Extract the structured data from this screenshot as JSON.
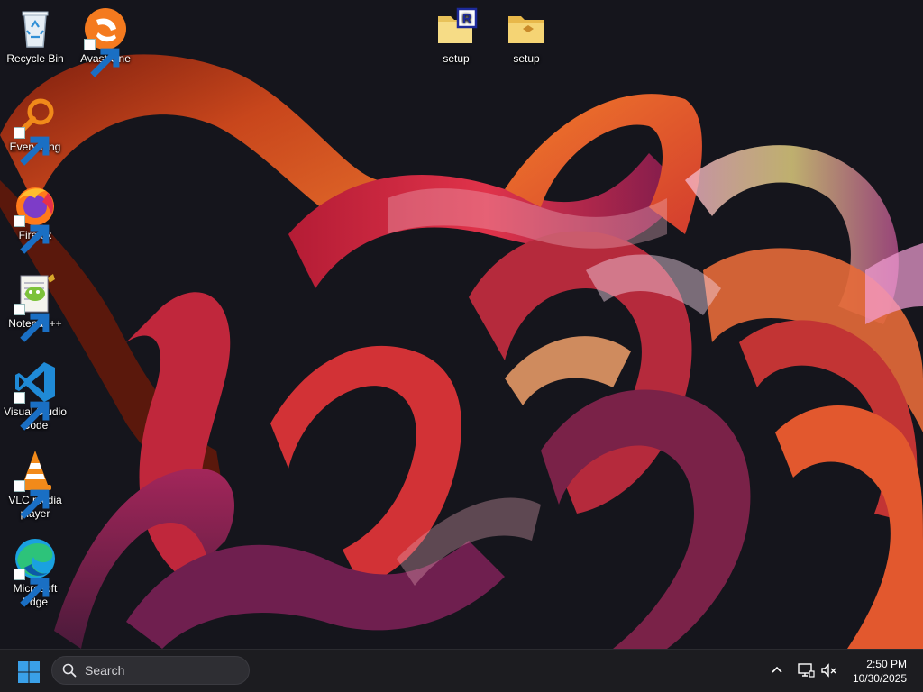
{
  "desktop": {
    "icons": [
      {
        "label": "Recycle Bin",
        "icon": "recycle-bin-icon",
        "shortcut": false
      },
      {
        "label": "Avast One",
        "icon": "avast-one-icon",
        "shortcut": true
      },
      {
        "label": "setup",
        "icon": "folder-icon",
        "shortcut": false
      },
      {
        "label": "setup",
        "icon": "folder-icon",
        "shortcut": false
      },
      {
        "label": "Everything",
        "icon": "everything-search-icon",
        "shortcut": true
      },
      {
        "label": "Firefox",
        "icon": "firefox-icon",
        "shortcut": true
      },
      {
        "label": "Notepad++",
        "icon": "notepad-plus-plus-icon",
        "shortcut": true
      },
      {
        "label": "Visual Studio Code",
        "icon": "vscode-icon",
        "shortcut": true
      },
      {
        "label": "VLC media player",
        "icon": "vlc-icon",
        "shortcut": true
      },
      {
        "label": "Microsoft Edge",
        "icon": "edge-icon",
        "shortcut": true
      }
    ]
  },
  "taskbar": {
    "search_placeholder": "Search",
    "time": "2:50 PM",
    "date": "10/30/2025"
  },
  "colors": {
    "taskbar_bg": "#1c1c20",
    "accent_blue": "#3aa0e8",
    "wallpaper_dark": "#15151c",
    "ribbon_orange": "#e8602a",
    "ribbon_red": "#d4253a",
    "ribbon_purple": "#8a2c6a"
  }
}
